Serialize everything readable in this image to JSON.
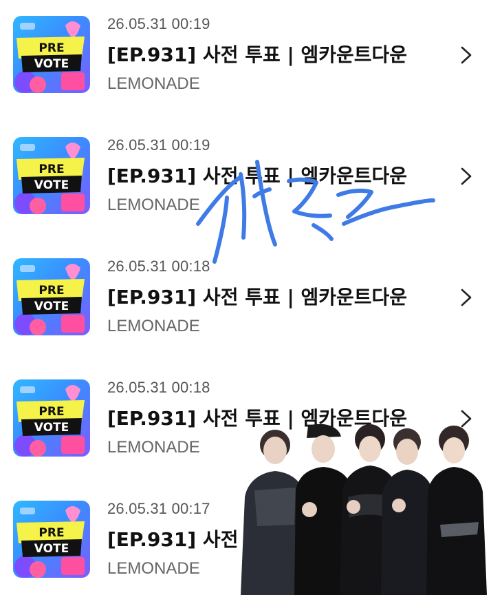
{
  "items": [
    {
      "date": "26.05.31 00:19",
      "title": "[EP.931] 사전 투표 | 엠카운트다운",
      "artist": "LEMONADE",
      "thumb_text_1": "PRE",
      "thumb_text_2": "VOTE"
    },
    {
      "date": "26.05.31 00:19",
      "title": "[EP.931] 사전 투표 | 엠카운트다운",
      "artist": "LEMONADE",
      "thumb_text_1": "PRE",
      "thumb_text_2": "VOTE"
    },
    {
      "date": "26.05.31 00:18",
      "title": "[EP.931] 사전 투표 | 엠카운트다운",
      "artist": "LEMONADE",
      "thumb_text_1": "PRE",
      "thumb_text_2": "VOTE"
    },
    {
      "date": "26.05.31 00:18",
      "title": "[EP.931] 사전 투표 | 엠카운트다운",
      "artist": "LEMONADE",
      "thumb_text_1": "PRE",
      "thumb_text_2": "VOTE"
    },
    {
      "date": "26.05.31 00:17",
      "title": "[EP.931] 사전 투표 | 엠카운트다운",
      "artist": "LEMONADE",
      "thumb_text_1": "PRE",
      "thumb_text_2": "VOTE"
    }
  ],
  "overlay": {
    "handwriting_color": "#3f7be6",
    "photo_icon": "group-photo"
  },
  "colors": {
    "thumb_yellow": "#f5f24a",
    "thumb_pink": "#f36fb0",
    "thumb_blue": "#2f9cff"
  }
}
